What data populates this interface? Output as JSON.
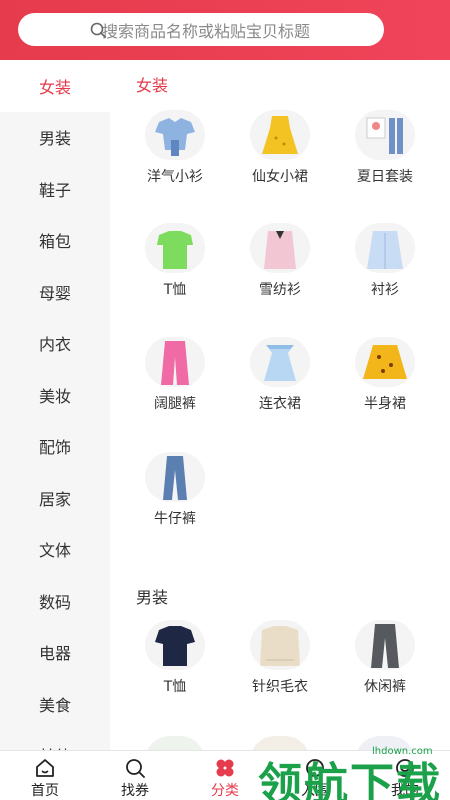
{
  "search": {
    "placeholder": "搜索商品名称或粘贴宝贝标题"
  },
  "sidebar": {
    "items": [
      {
        "label": "女装",
        "active": true
      },
      {
        "label": "男装"
      },
      {
        "label": "鞋子"
      },
      {
        "label": "箱包"
      },
      {
        "label": "母婴"
      },
      {
        "label": "内衣"
      },
      {
        "label": "美妆"
      },
      {
        "label": "配饰"
      },
      {
        "label": "居家"
      },
      {
        "label": "文体"
      },
      {
        "label": "数码"
      },
      {
        "label": "电器"
      },
      {
        "label": "美食"
      },
      {
        "label": "其他"
      }
    ]
  },
  "sections": [
    {
      "title": "女装",
      "items": [
        {
          "label": "洋气小衫"
        },
        {
          "label": "仙女小裙"
        },
        {
          "label": "夏日套装"
        },
        {
          "label": "T恤"
        },
        {
          "label": "雪纺衫"
        },
        {
          "label": "衬衫"
        },
        {
          "label": "阔腿裤"
        },
        {
          "label": "连衣裙"
        },
        {
          "label": "半身裙"
        },
        {
          "label": "牛仔裤"
        }
      ]
    },
    {
      "title": "男装",
      "items": [
        {
          "label": "T恤"
        },
        {
          "label": "针织毛衣"
        },
        {
          "label": "休闲裤"
        }
      ]
    }
  ],
  "tabbar": {
    "tabs": [
      {
        "label": "首页",
        "icon": "home-icon"
      },
      {
        "label": "找券",
        "icon": "coupon-search-icon"
      },
      {
        "label": "分类",
        "icon": "category-icon",
        "active": true
      },
      {
        "label": "入围",
        "icon": "shortlist-icon"
      },
      {
        "label": "我的",
        "icon": "profile-icon"
      }
    ]
  },
  "watermark": {
    "text": "领航下载",
    "url": "lhdown.com"
  },
  "colors": {
    "accent": "#e53b4c",
    "sidebar_bg": "#f6f6f6"
  }
}
